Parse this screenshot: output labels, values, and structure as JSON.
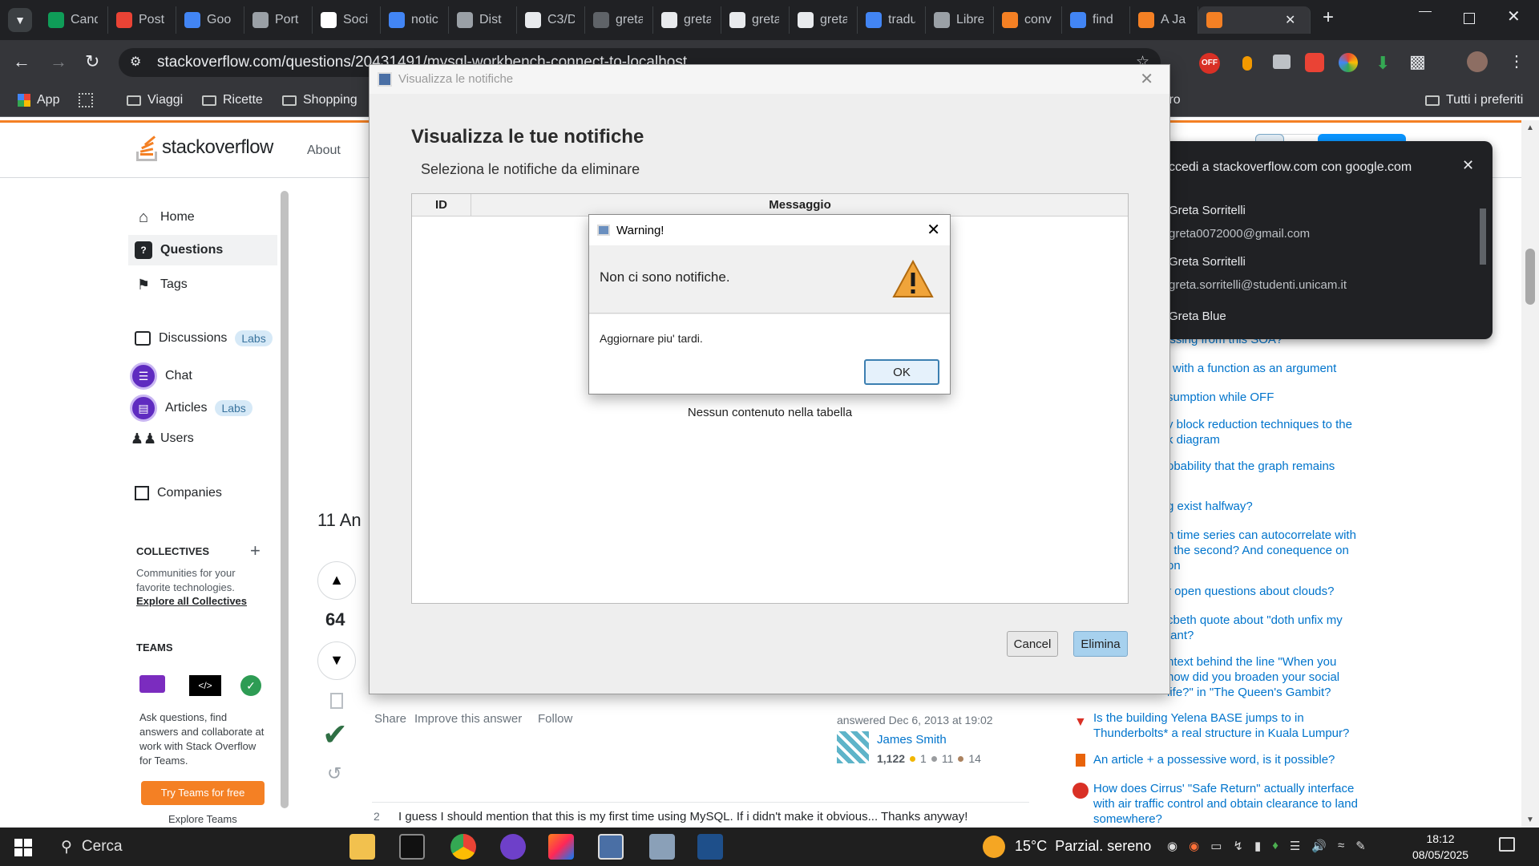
{
  "browser": {
    "tabs": [
      {
        "title": "Cand",
        "color": "#0f9d58",
        "icon": "plus-icon"
      },
      {
        "title": "Post",
        "color": "#ea4335",
        "icon": "gmail-icon"
      },
      {
        "title": "Goo",
        "color": "#4285f4",
        "icon": "google-slides-icon"
      },
      {
        "title": "Port",
        "color": "#9aa0a6",
        "icon": "chatgpt-icon"
      },
      {
        "title": "Soci",
        "color": "#ffffff",
        "icon": "notion-icon"
      },
      {
        "title": "notic",
        "color": "#4285f4",
        "icon": "google-icon"
      },
      {
        "title": "Dist",
        "color": "#9aa0a6",
        "icon": "chatgpt-icon"
      },
      {
        "title": "C3/D",
        "color": "#e8eaed",
        "icon": "github-icon"
      },
      {
        "title": "greta",
        "color": "#5f6368",
        "icon": "github-icon"
      },
      {
        "title": "greta",
        "color": "#e8eaed",
        "icon": "github-icon"
      },
      {
        "title": "greta",
        "color": "#e8eaed",
        "icon": "github-icon"
      },
      {
        "title": "greta",
        "color": "#e8eaed",
        "icon": "github-icon"
      },
      {
        "title": "tradu",
        "color": "#4285f4",
        "icon": "google-icon"
      },
      {
        "title": "Libre",
        "color": "#9aa0a6",
        "icon": "libre-icon"
      },
      {
        "title": "conv",
        "color": "#f48024",
        "icon": "stackoverflow-icon"
      },
      {
        "title": "find",
        "color": "#4285f4",
        "icon": "google-icon"
      },
      {
        "title": "A Ja",
        "color": "#f48024",
        "icon": "stackoverflow-icon"
      }
    ],
    "url": "stackoverflow.com/questions/20431491/mysql-workbench-connect-to-localhost",
    "bookmarks": [
      "App",
      "Viaggi",
      "Ricette",
      "Shopping"
    ],
    "bookmarks_right": "Tutti i preferiti",
    "bookmark_partial": "tro",
    "extension_badge": "OFF"
  },
  "so": {
    "logo_text": "stackoverflow",
    "about": "About",
    "nav": {
      "home": "Home",
      "questions": "Questions",
      "tags": "Tags",
      "discussions": "Discussions",
      "labs": "Labs",
      "chat": "Chat",
      "articles": "Articles",
      "users": "Users",
      "companies": "Companies"
    },
    "collectives_heading": "COLLECTIVES",
    "collectives_text": "Communities for your favorite technologies.",
    "collectives_link": "Explore all Collectives",
    "teams_heading": "TEAMS",
    "teams_text": "Ask questions, find answers and collaborate at work with Stack Overflow for Teams.",
    "teams_button": "Try Teams for free",
    "explore_teams": "Explore Teams",
    "answers_count": "11 An",
    "vote_count": "64",
    "share": "Share",
    "improve": "Improve this answer",
    "follow": "Follow",
    "answered": "answered Dec 6, 2013 at 19:02",
    "user_name": "James Smith",
    "reputation": "1,122",
    "badge_gold": "1",
    "badge_silver": "11",
    "badge_bronze": "14",
    "comment_votes": "2",
    "comment_text": "I guess I should mention that this is my first time using MySQL. If i didn't make it obvious... Thanks anyway!",
    "right_questions": [
      "issing from this SOA?",
      "' with a function as an argument",
      "sumption while OFF",
      "y block reduction techniques to the k diagram",
      "obability that the graph remains",
      "g exist halfway?",
      "n time series can autocorrelate with t the second? And conequence on on",
      "r open questions about clouds?",
      "cbeth quote about \"doth unfix my tant?",
      "ntext behind the line \"When you how did you broaden your social life?\" in \"The Queen's Gambit?",
      "Is the building Yelena BASE jumps to in Thunderbolts* a real structure in Kuala Lumpur?",
      "An article + a possessive word, is it possible?",
      "How does Cirrus' \"Safe Return\" actually interface with air traffic control and obtain clearance to land somewhere?"
    ]
  },
  "dialog": {
    "window_title": "Visualizza le notifiche",
    "heading": "Visualizza le tue notifiche",
    "subheading": "Seleziona le notifiche da eliminare",
    "columns": [
      "ID",
      "Messaggio"
    ],
    "empty_text": "Nessun contenuto nella tabella",
    "cancel": "Cancel",
    "delete": "Elimina"
  },
  "warning": {
    "title": "Warning!",
    "message": "Non ci sono notifiche.",
    "detail": "Aggiornare piu' tardi.",
    "ok": "OK"
  },
  "google_popup": {
    "title": "ccedi a stackoverflow.com con google.com",
    "accounts": [
      {
        "name": "Greta Sorritelli",
        "email": "greta0072000@gmail.com"
      },
      {
        "name": "Greta Sorritelli",
        "email": "greta.sorritelli@studenti.unicam.it"
      },
      {
        "name": "Greta Blue",
        "email": ""
      }
    ]
  },
  "taskbar": {
    "search": "Cerca",
    "weather": "15°C  Parzial. sereno",
    "time": "18:12",
    "date": "08/05/2025"
  },
  "colors": {
    "so_orange": "#f48024",
    "so_link": "#0074cc",
    "java_button": "#cce4f7"
  }
}
